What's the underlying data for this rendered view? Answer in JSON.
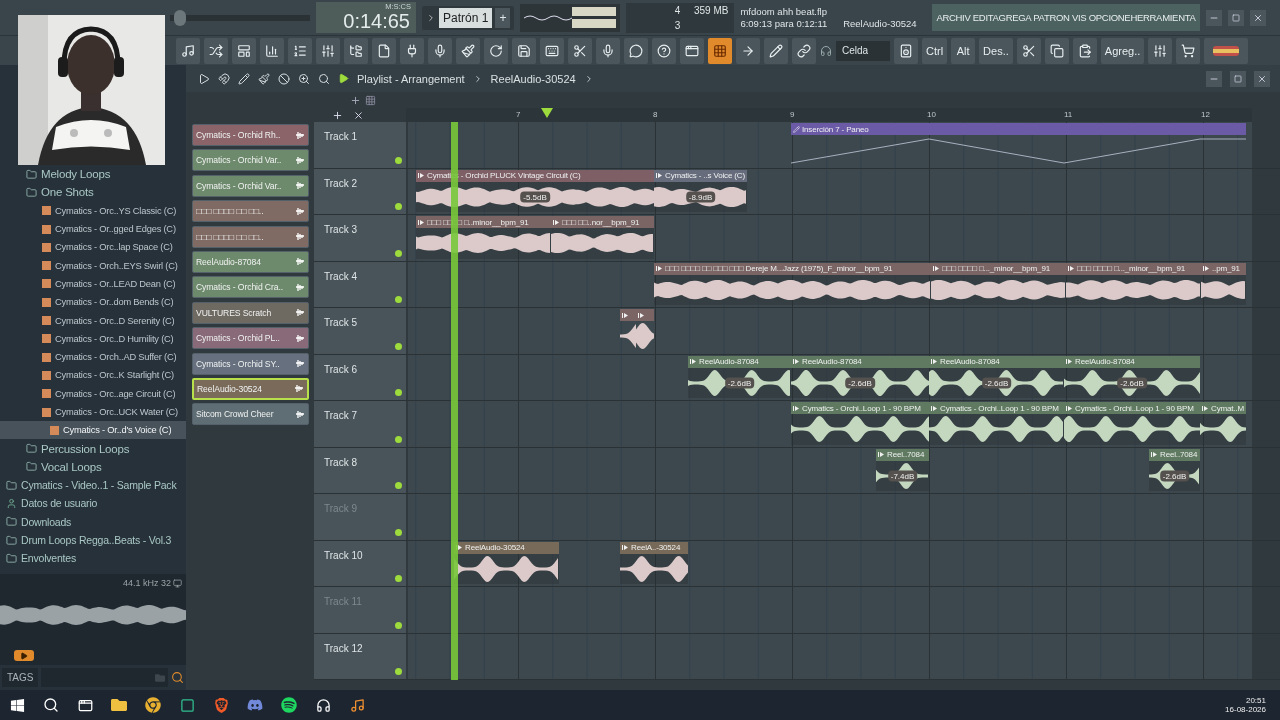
{
  "master": {
    "level": 0.03
  },
  "transport": {
    "time": "0:14:65",
    "time_format": "M:S:CS",
    "pattern": "Patrón 1",
    "add_pattern": "+"
  },
  "monitor": {
    "cpu": "4",
    "memory": "359 MB",
    "polyphony": "3"
  },
  "song": {
    "file": "mfdoom ahh beat.flp",
    "position": "6:09:13 para 0:12:11",
    "current": "ReelAudio-30524"
  },
  "menu": "ARCHIV EDITAGREGA PATRON VIS OPCIONEHERRAMIENTA",
  "toolbar": {
    "snap": "Celda",
    "keys": [
      "Ctrl",
      "Alt",
      "Des.."
    ],
    "add": "Agreg.."
  },
  "browser": {
    "folders": [
      {
        "label": "Melody Loops",
        "kind": "folder"
      },
      {
        "label": "One Shots",
        "kind": "folder",
        "children": [
          {
            "label": "Cymatics - Orc..YS Classic (C)",
            "kind": "file",
            "selected": false
          },
          {
            "label": "Cymatics - Or..gged Edges (C)",
            "kind": "file",
            "selected": false
          },
          {
            "label": "Cymatics - Orc..lap Space (C)",
            "kind": "file",
            "selected": false
          },
          {
            "label": "Cymatics - Orch..EYS Swirl (C)",
            "kind": "file",
            "selected": false
          },
          {
            "label": "Cymatics - Or..LEAD Dean (C)",
            "kind": "file",
            "selected": false
          },
          {
            "label": "Cymatics - Or..dom Bends (C)",
            "kind": "file",
            "selected": false
          },
          {
            "label": "Cymatics - Orc..D Serenity (C)",
            "kind": "file",
            "selected": false
          },
          {
            "label": "Cymatics - Orc..D Humility (C)",
            "kind": "file",
            "selected": false
          },
          {
            "label": "Cymatics - Orch..AD Suffer (C)",
            "kind": "file",
            "selected": false
          },
          {
            "label": "Cymatics - Orc..K Starlight (C)",
            "kind": "file",
            "selected": false
          },
          {
            "label": "Cymatics - Orc..age Circuit (C)",
            "kind": "file",
            "selected": false
          },
          {
            "label": "Cymatics - Orc..UCK Water (C)",
            "kind": "file",
            "selected": false
          },
          {
            "label": "Cymatics - Or..d's Voice (C)",
            "kind": "file",
            "selected": true
          }
        ]
      },
      {
        "label": "Percussion Loops",
        "kind": "folder"
      },
      {
        "label": "Vocal Loops",
        "kind": "folder"
      }
    ],
    "places": [
      {
        "label": "Cymatics - Video..1 - Sample Pack",
        "kind": "folder"
      },
      {
        "label": "Datos de usuario",
        "kind": "user"
      },
      {
        "label": "Downloads",
        "kind": "folder"
      },
      {
        "label": "Drum Loops Regga..Beats - Vol.3",
        "kind": "folder"
      },
      {
        "label": "Envolventes",
        "kind": "folder"
      }
    ],
    "preview": {
      "rate": "44.1",
      "rate_unit": "kHz",
      "bits": "32"
    },
    "tags": "TAGS"
  },
  "channels": [
    {
      "label": "Cymatics - Orchid Rh..",
      "color": "#8a6468",
      "selected": false
    },
    {
      "label": "Cymatics - Orchid Var..",
      "color": "#6e8a6c",
      "selected": false
    },
    {
      "label": "Cymatics - Orchid Var..",
      "color": "#6e8a6c",
      "selected": false
    },
    {
      "label": "□□□ □□□□ □□ □□..",
      "color": "#806a64",
      "selected": false
    },
    {
      "label": "□□□ □□□□ □□ □□..",
      "color": "#806a64",
      "selected": false
    },
    {
      "label": "ReelAudio-87084",
      "color": "#6e8a6c",
      "selected": false
    },
    {
      "label": "Cymatics - Orchid Cra..",
      "color": "#6e8a6c",
      "selected": false
    },
    {
      "label": "VULTURES Scratch",
      "color": "#6e6a62",
      "selected": false
    },
    {
      "label": "Cymatics - Orchid PL..",
      "color": "#886a78",
      "selected": false
    },
    {
      "label": "Cymatics - Orchid SY..",
      "color": "#66707e",
      "selected": false
    },
    {
      "label": "ReelAudio-30524",
      "color": "#7a6a5a",
      "selected": true
    },
    {
      "label": "Sitcom Crowd Cheer",
      "color": "#5f6e74",
      "selected": false
    }
  ],
  "playlist": {
    "title": "Playlist - Arrangement",
    "breadcrumb": "ReelAudio-30524",
    "ruler": [
      "7",
      "8",
      "9",
      "10",
      "11",
      "12"
    ],
    "tracks": [
      {
        "name": "Track 1",
        "dimmed": false,
        "clips": [
          {
            "kind": "automation",
            "label": "Inserción 7 - Paneo",
            "color": "#6b5aa6"
          }
        ]
      },
      {
        "name": "Track 2",
        "dimmed": false,
        "clips": [
          {
            "kind": "audio",
            "label": "Cymatics - Orchid PLUCK Vintage Circuit (C)",
            "gain": "-5.5dB",
            "color": "#7e5f66"
          },
          {
            "kind": "audio",
            "label": "Cymatics - ..s Voice (C)",
            "gain": "-8.9dB",
            "color": "#666c7c"
          }
        ]
      },
      {
        "name": "Track 3",
        "dimmed": false,
        "clips": [
          {
            "kind": "audio",
            "label": "□□□ □□□□ □..minor__bpm_91",
            "color": "#7a6464"
          },
          {
            "kind": "audio",
            "label": "□□□ □□..nor__bpm_91",
            "color": "#7a6464"
          }
        ]
      },
      {
        "name": "Track 4",
        "dimmed": false,
        "clips": [
          {
            "kind": "audio",
            "label": "□□□ □□□□ □□ □□□ □□□ Dereje M...Jazz (1975)_F_minor__bpm_91",
            "color": "#7a6464"
          },
          {
            "kind": "audio",
            "label": "□□□ □□□□ □..._minor__bpm_91",
            "color": "#7a6464"
          },
          {
            "kind": "audio",
            "label": "□□□ □□□□ □..._minor__bpm_91",
            "color": "#7a6464"
          },
          {
            "kind": "audio",
            "label": "..pm_91",
            "color": "#7a6464"
          }
        ]
      },
      {
        "name": "Track 5",
        "dimmed": false,
        "clips": [
          {
            "kind": "stub",
            "color": "#7a6464"
          },
          {
            "kind": "stub",
            "color": "#7a6464"
          }
        ]
      },
      {
        "name": "Track 6",
        "dimmed": false,
        "clips": [
          {
            "kind": "audio",
            "label": "ReelAudio-87084",
            "gain": "-2.6dB",
            "color": "#5f7a60"
          },
          {
            "kind": "audio",
            "label": "ReelAudio-87084",
            "gain": "-2.6dB",
            "color": "#5f7a60"
          },
          {
            "kind": "audio",
            "label": "ReelAudio-87084",
            "gain": "-2.6dB",
            "color": "#5f7a60"
          },
          {
            "kind": "audio",
            "label": "ReelAudio-87084",
            "gain": "-2.6dB",
            "color": "#5f7a60"
          }
        ]
      },
      {
        "name": "Track 7",
        "dimmed": false,
        "clips": [
          {
            "kind": "audio",
            "label": "Cymatics - Orchi..Loop 1 - 90 BPM",
            "color": "#5f7a60"
          },
          {
            "kind": "audio",
            "label": "Cymatics - Orchi..Loop 1 - 90 BPM",
            "color": "#5f7a60"
          },
          {
            "kind": "audio",
            "label": "Cymatics - Orchi..Loop 1 - 90 BPM",
            "color": "#5f7a60"
          },
          {
            "kind": "audio",
            "label": "Cymat..M",
            "color": "#5f7a60"
          }
        ]
      },
      {
        "name": "Track 8",
        "dimmed": false,
        "clips": [
          {
            "kind": "audio",
            "label": "Reel..7084",
            "gain": "-7.4dB",
            "color": "#5f7a60"
          },
          {
            "kind": "audio",
            "label": "Reel..7084",
            "gain": "-2.6dB",
            "color": "#5f7a60"
          }
        ]
      },
      {
        "name": "Track 9",
        "dimmed": true
      },
      {
        "name": "Track 10",
        "dimmed": false,
        "clips": [
          {
            "kind": "audio",
            "label": "ReelAudio-30524",
            "color": "#786a58"
          },
          {
            "kind": "audio",
            "label": "ReelA..-30524",
            "color": "#786a58"
          }
        ]
      },
      {
        "name": "Track 11",
        "dimmed": true
      },
      {
        "name": "Track 12",
        "dimmed": false
      }
    ]
  },
  "taskbar": {
    "time": "20:51",
    "date": "16-08-2026"
  }
}
